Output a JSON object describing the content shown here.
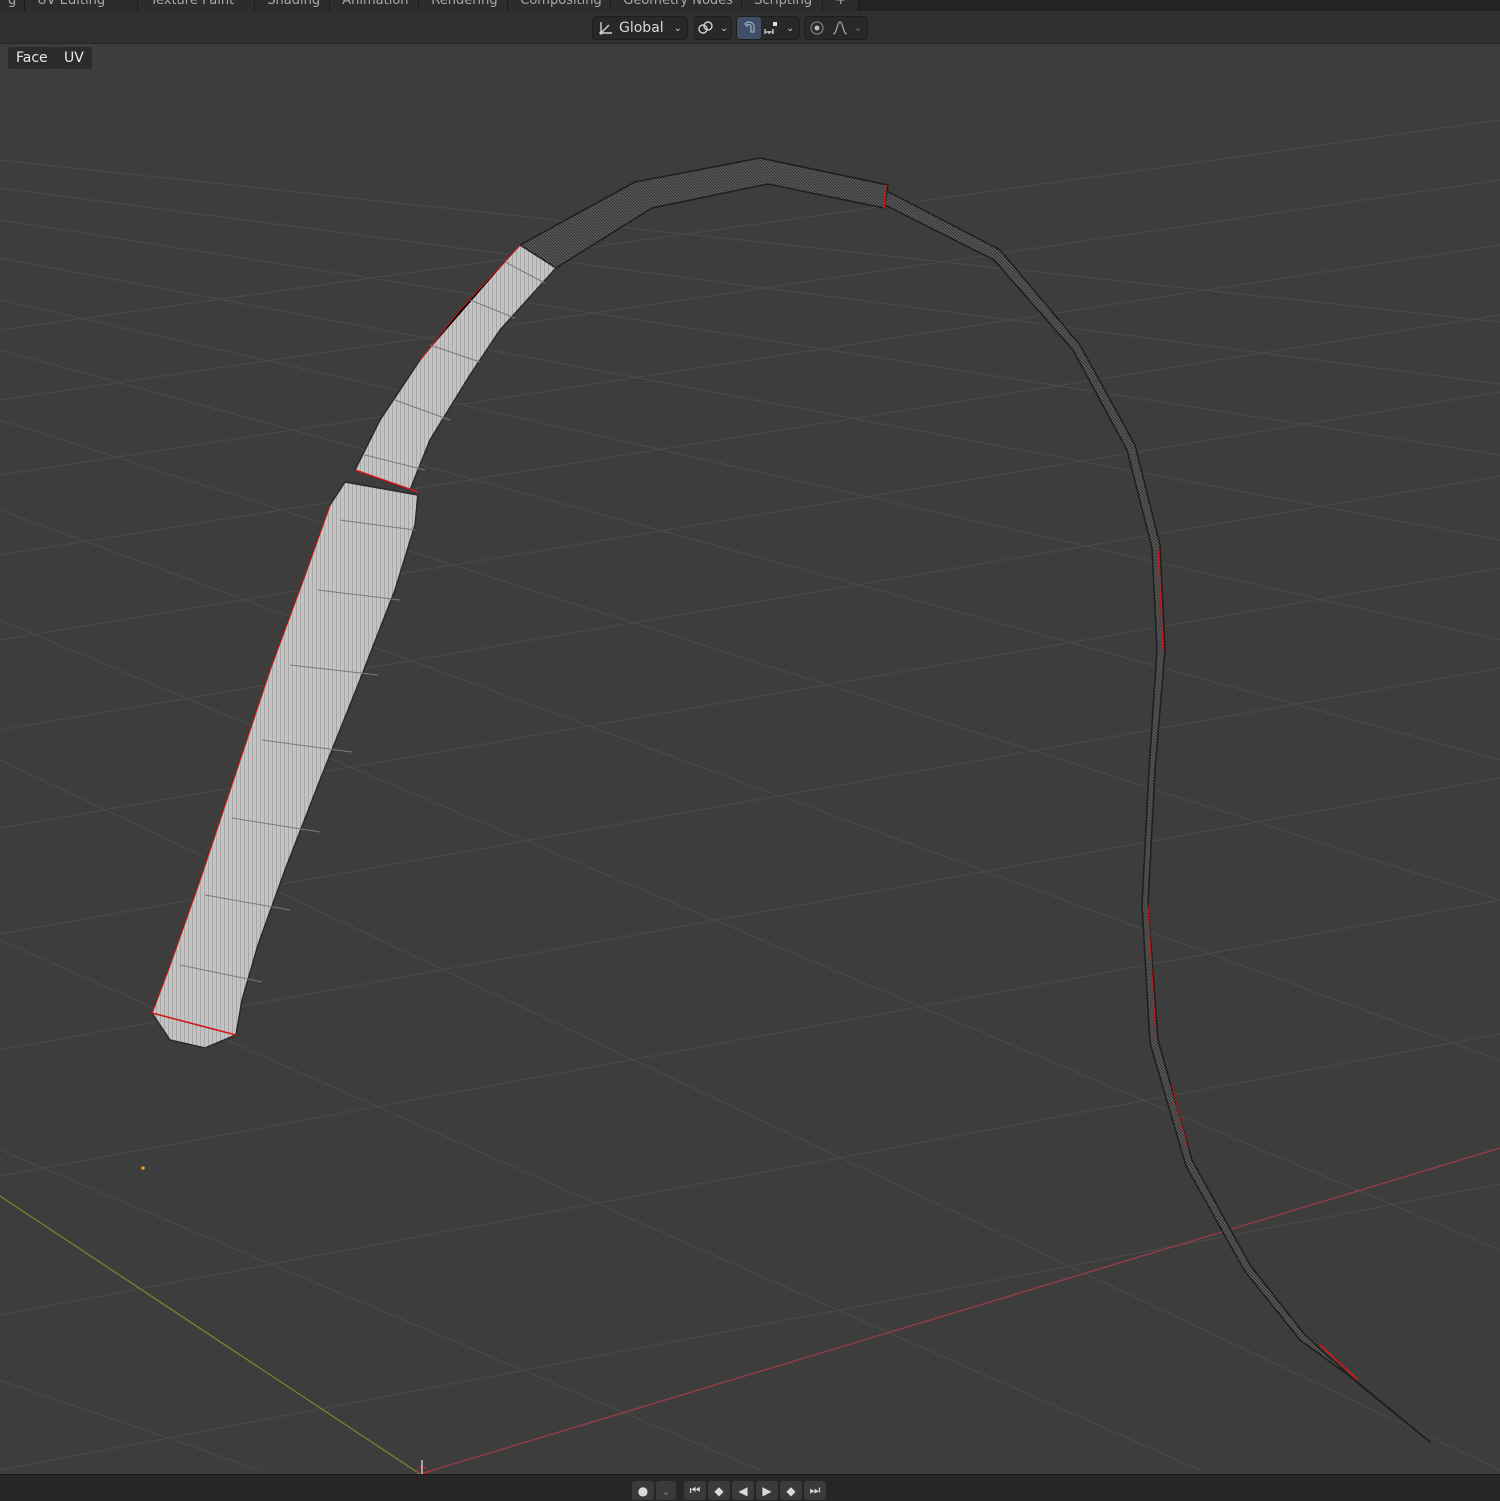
{
  "workspace_tabs": [
    "g",
    "UV Editing",
    "Texture Paint",
    "Shading",
    "Animation",
    "Rendering",
    "Compositing",
    "Geometry Nodes",
    "Scripting",
    "+"
  ],
  "header": {
    "orientation_label": "Global"
  },
  "viewport_menu": {
    "face_label": "Face",
    "uv_label": "UV"
  },
  "icons": {
    "orientation": "transform-orientation-icon",
    "pivot": "pivot-link-icon",
    "snap": "magnet-snap-icon",
    "snap_target": "snap-increment-icon",
    "proportional": "proportional-edit-icon",
    "falloff": "falloff-curve-icon"
  },
  "timeline": {
    "record": "record-icon",
    "controls": [
      "jump-start-icon",
      "prev-keyframe-icon",
      "play-reverse-icon",
      "play-icon",
      "next-keyframe-icon",
      "jump-end-icon"
    ]
  },
  "colors": {
    "background": "#3d3d3d",
    "grid": "#4a4a4a",
    "x_axis": "#9a3d45",
    "y_axis": "#6b8a2a",
    "seam": "#d01818",
    "mesh_light": "#c4c4c4",
    "mesh_dark": "#3a3a3a",
    "active_blue": "#3e4f66",
    "origin_dot": "#e89a20"
  }
}
